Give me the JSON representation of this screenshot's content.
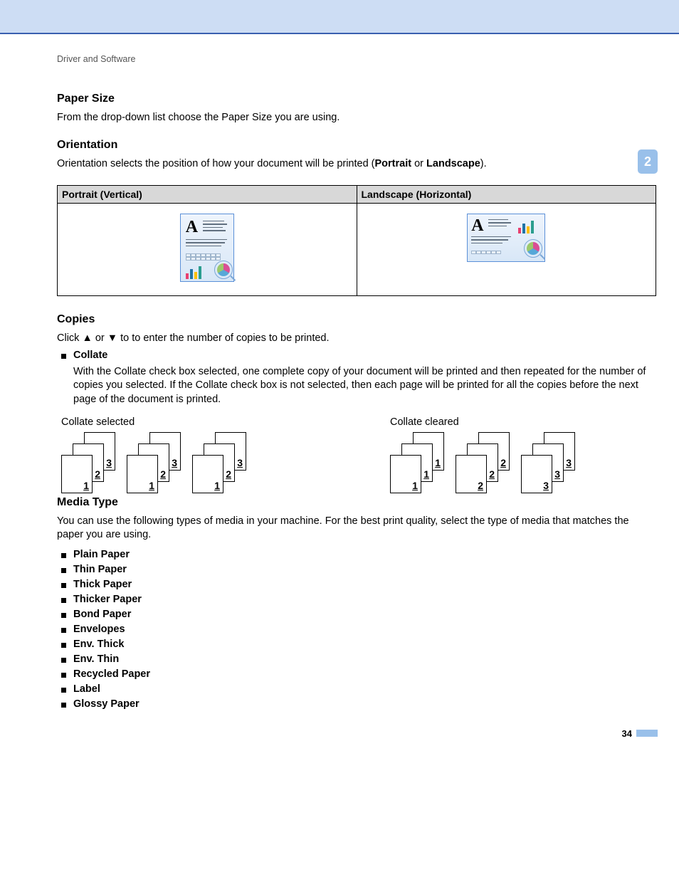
{
  "breadcrumb": "Driver and Software",
  "side_tab": "2",
  "page_number": "34",
  "paper_size": {
    "heading": "Paper Size",
    "body": "From the drop-down list choose the Paper Size you are using."
  },
  "orientation": {
    "heading": "Orientation",
    "body_pre": "Orientation selects the position of how your document will be printed (",
    "bold1": "Portrait",
    "body_mid": " or ",
    "bold2": "Landscape",
    "body_post": ").",
    "th1": "Portrait (Vertical)",
    "th2": "Landscape (Horizontal)"
  },
  "copies": {
    "heading": "Copies",
    "body": "Click ▲ or ▼ to to enter the number of copies to be printed.",
    "collate_label": "Collate",
    "collate_body": "With the Collate check box selected, one complete copy of your document will be printed and then repeated for the number of copies you selected. If the Collate check box is not selected, then each page will be printed for all the copies before the next page of the document is printed.",
    "diag1_label": "Collate selected",
    "diag2_label": "Collate cleared",
    "selected_stacks": [
      [
        "1",
        "2",
        "3"
      ],
      [
        "1",
        "2",
        "3"
      ],
      [
        "1",
        "2",
        "3"
      ]
    ],
    "cleared_stacks": [
      [
        "1",
        "1",
        "1"
      ],
      [
        "2",
        "2",
        "2"
      ],
      [
        "3",
        "3",
        "3"
      ]
    ]
  },
  "media_type": {
    "heading": "Media Type",
    "body": "You can use the following types of media in your machine. For the best print quality, select the type of media that matches the paper you are using.",
    "items": [
      "Plain Paper",
      "Thin Paper",
      "Thick Paper",
      "Thicker Paper",
      "Bond Paper",
      "Envelopes",
      "Env. Thick",
      "Env. Thin",
      "Recycled Paper",
      "Label",
      "Glossy Paper"
    ]
  }
}
